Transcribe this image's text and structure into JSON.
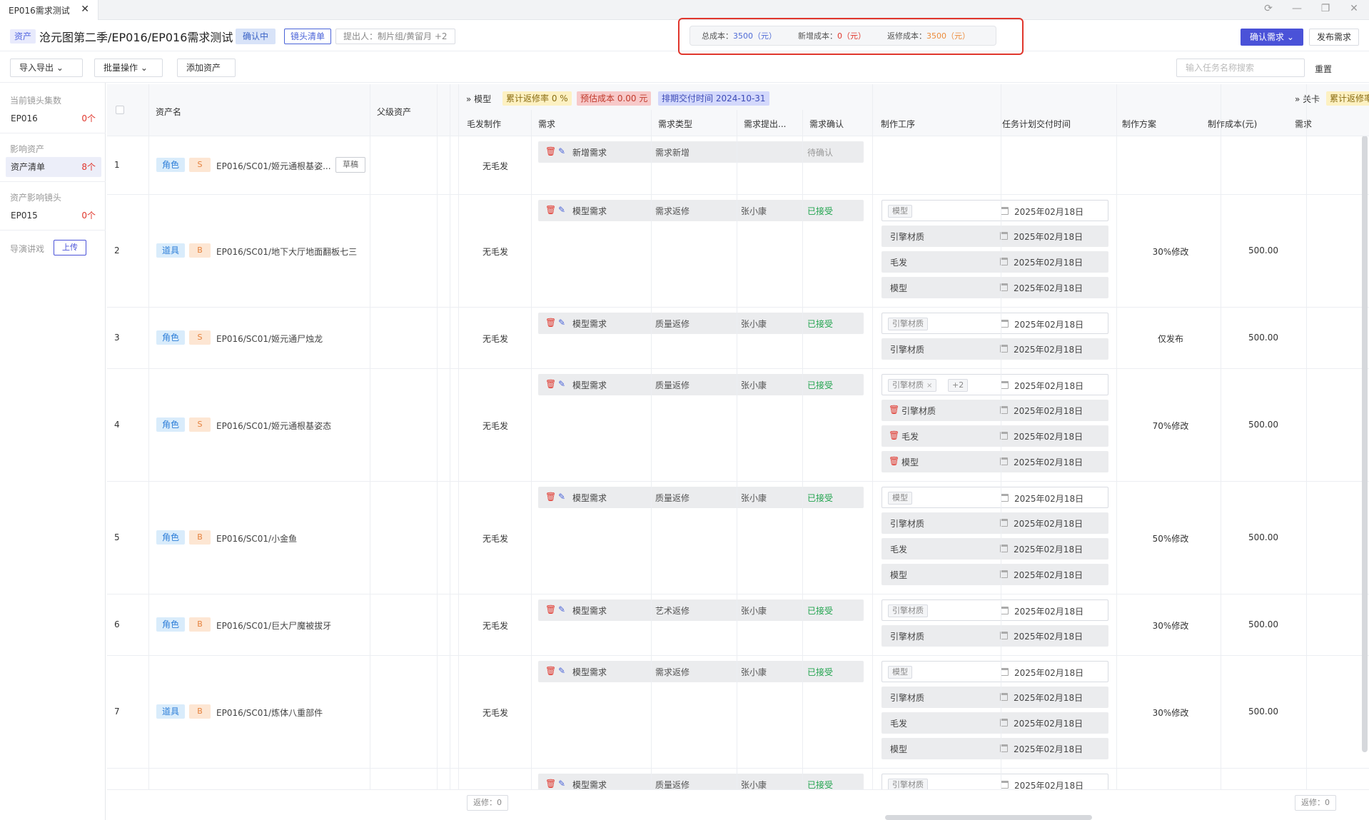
{
  "tab": {
    "title": "EP016需求测试",
    "close": "✕"
  },
  "header": {
    "asset_tag": "资产",
    "title": "沧元图第二季/EP016/EP016需求测试",
    "status": "确认中",
    "shot_list": "镜头清单",
    "proposer": "提出人：制片组/黄留月 +2",
    "confirm": "确认需求",
    "publish": "发布需求"
  },
  "cost": {
    "total_label": "总成本：",
    "total_value": "3500",
    "total_unit": "（元）",
    "new_label": "新增成本：",
    "new_value": "0",
    "new_unit": "（元）",
    "rework_label": "返修成本：",
    "rework_value": "3500",
    "rework_unit": "（元）"
  },
  "toolbar": {
    "import_export": "导入导出",
    "batch": "批量操作",
    "add_asset": "添加资产",
    "search_placeholder": "输入任务名称搜索",
    "reset": "重置"
  },
  "sidebar": {
    "groups": [
      "当前镜头集数",
      "影响资产",
      "资产影响镜头",
      "导演讲戏"
    ],
    "items": [
      {
        "label": "EP016",
        "count": "0个"
      },
      {
        "label": "资产清单",
        "count": "8个"
      },
      {
        "label": "EP015",
        "count": "0个"
      }
    ],
    "upload": "上传"
  },
  "table": {
    "headers": {
      "asset_name": "资产名",
      "parent": "父级资产",
      "hair": "毛发制作",
      "req": "需求",
      "req_type": "需求类型",
      "req_by": "需求提出...",
      "req_confirm": "需求确认",
      "process": "制作工序",
      "delivery": "任务计划交付时间",
      "plan": "制作方案",
      "cost": "制作成本(元)",
      "req2": "需求"
    },
    "band": {
      "model": "模型",
      "rework_rate": "累计返修率 0 %",
      "est_cost": "预估成本 0.00 元",
      "delivery": "排期交付时间 2024-10-31",
      "card": "关卡",
      "rework_rate2": "累计返修率"
    },
    "rows": [
      {
        "idx": "1",
        "type": "角色",
        "grade": "S",
        "name": "EP016/SC01/姬元通根基姿...",
        "draft": "草稿",
        "hair": "无毛发",
        "req": {
          "name": "新增需求",
          "type": "需求新增",
          "by": "",
          "status": "待确认"
        },
        "processes": [],
        "plan": "",
        "cost": ""
      },
      {
        "idx": "2",
        "type": "道具",
        "grade": "B",
        "name": "EP016/SC01/地下大厅地面翻板七三",
        "hair": "无毛发",
        "req": {
          "name": "模型需求",
          "type": "需求返修",
          "by": "张小康",
          "status": "已接受"
        },
        "processes": [
          {
            "name": "模型",
            "date": "2025年02月18日"
          },
          {
            "name": "引擎材质",
            "date": "2025年02月18日"
          },
          {
            "name": "毛发",
            "date": "2025年02月18日"
          },
          {
            "name": "模型",
            "date": "2025年02月18日"
          }
        ],
        "plan": "30%修改",
        "cost": "500.00"
      },
      {
        "idx": "3",
        "type": "角色",
        "grade": "S",
        "name": "EP016/SC01/姬元通尸烛龙",
        "hair": "无毛发",
        "req": {
          "name": "模型需求",
          "type": "质量返修",
          "by": "张小康",
          "status": "已接受"
        },
        "processes": [
          {
            "name": "引擎材质",
            "date": "2025年02月18日"
          },
          {
            "name": "引擎材质",
            "date": "2025年02月18日"
          }
        ],
        "plan": "仅发布",
        "cost": "500.00"
      },
      {
        "idx": "4",
        "type": "角色",
        "grade": "S",
        "name": "EP016/SC01/姬元通根基姿态",
        "hair": "无毛发",
        "req": {
          "name": "模型需求",
          "type": "质量返修",
          "by": "张小康",
          "status": "已接受"
        },
        "processes": [
          {
            "name": "引擎材质",
            "more": "+2",
            "date": "2025年02月18日"
          },
          {
            "name": "引擎材质",
            "date": "2025年02月18日"
          },
          {
            "name": "毛发",
            "date": "2025年02月18日"
          },
          {
            "name": "模型",
            "date": "2025年02月18日"
          }
        ],
        "plan": "70%修改",
        "cost": "500.00"
      },
      {
        "idx": "5",
        "type": "角色",
        "grade": "B",
        "name": "EP016/SC01/小金鱼",
        "hair": "无毛发",
        "req": {
          "name": "模型需求",
          "type": "质量返修",
          "by": "张小康",
          "status": "已接受"
        },
        "processes": [
          {
            "name": "模型",
            "date": "2025年02月18日"
          },
          {
            "name": "引擎材质",
            "date": "2025年02月18日"
          },
          {
            "name": "毛发",
            "date": "2025年02月18日"
          },
          {
            "name": "模型",
            "date": "2025年02月18日"
          }
        ],
        "plan": "50%修改",
        "cost": "500.00"
      },
      {
        "idx": "6",
        "type": "角色",
        "grade": "B",
        "name": "EP016/SC01/巨大尸魔被拔牙",
        "hair": "无毛发",
        "req": {
          "name": "模型需求",
          "type": "艺术返修",
          "by": "张小康",
          "status": "已接受"
        },
        "processes": [
          {
            "name": "引擎材质",
            "date": "2025年02月18日"
          },
          {
            "name": "引擎材质",
            "date": "2025年02月18日"
          }
        ],
        "plan": "30%修改",
        "cost": "500.00"
      },
      {
        "idx": "7",
        "type": "道具",
        "grade": "B",
        "name": "EP016/SC01/炼体八重部件",
        "hair": "无毛发",
        "req": {
          "name": "模型需求",
          "type": "需求返修",
          "by": "张小康",
          "status": "已接受"
        },
        "processes": [
          {
            "name": "模型",
            "date": "2025年02月18日"
          },
          {
            "name": "引擎材质",
            "date": "2025年02月18日"
          },
          {
            "name": "毛发",
            "date": "2025年02月18日"
          },
          {
            "name": "模型",
            "date": "2025年02月18日"
          }
        ],
        "plan": "30%修改",
        "cost": "500.00"
      },
      {
        "idx": "",
        "type": "",
        "grade": "",
        "name": "",
        "hair": "",
        "req": {
          "name": "模型需求",
          "type": "质量返修",
          "by": "张小康",
          "status": "已接受"
        },
        "processes": [
          {
            "name": "引擎材质",
            "date": "2025年02月18日"
          }
        ],
        "plan": "",
        "cost": ""
      }
    ],
    "footer": {
      "rework_left": "返修：0",
      "rework_right": "返修：0"
    }
  }
}
